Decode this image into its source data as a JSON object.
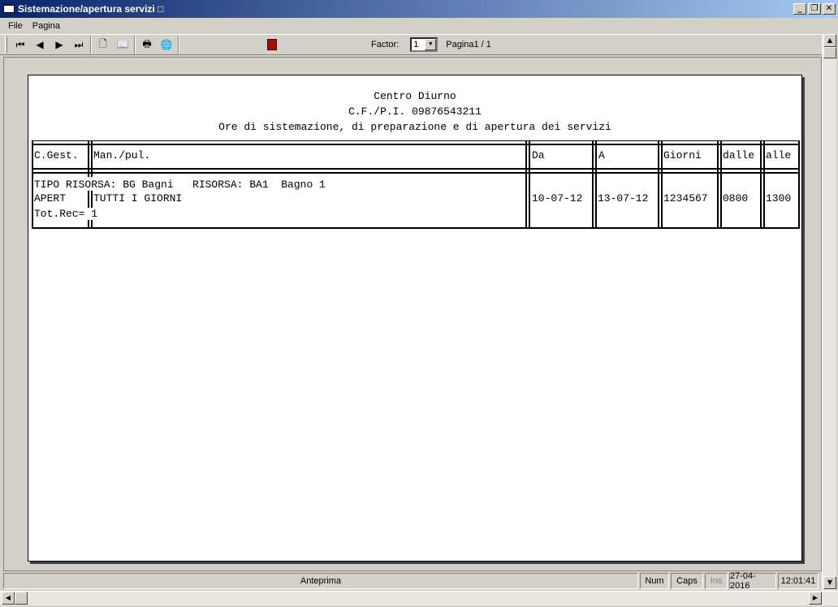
{
  "window": {
    "title": "Sistemazione/apertura servizi □"
  },
  "menu": {
    "items": [
      "File",
      "Pagina"
    ]
  },
  "toolbar": {
    "factor_label": "Factor:",
    "factor_value": "1",
    "page_info": "Pagina1 / 1",
    "icons": [
      "first-page-icon",
      "prev-page-icon",
      "next-page-icon",
      "last-page-icon",
      "single-page-icon",
      "two-page-icon",
      "print-icon",
      "export-icon",
      "exit-icon"
    ]
  },
  "report": {
    "line1": "Centro Diurno",
    "line2": "C.F./P.I. 09876543211",
    "line3": "Ore di sistemazione, di preparazione e di apertura dei servizi",
    "headers": {
      "cgest": "C.Gest.",
      "manpul": "Man./pul.",
      "da": "Da",
      "a": "A",
      "giorni": "Giorni",
      "dalle": "dalle",
      "alle": "alle"
    },
    "group_line": "TIPO RISORSA: BG Bagni   RISORSA: BA1  Bagno 1",
    "row": {
      "cgest": "APERT",
      "manpul": "TUTTI I GIORNI",
      "da": "10-07-12",
      "a": "13-07-12",
      "giorni": "1234567",
      "dalle": "0800",
      "alle": "1300"
    },
    "total": "Tot.Rec= 1"
  },
  "status": {
    "main": "Anteprima",
    "num": "Num",
    "caps": "Caps",
    "ins": "Ins",
    "date": "27-04-2016",
    "time": "12:01:41"
  }
}
